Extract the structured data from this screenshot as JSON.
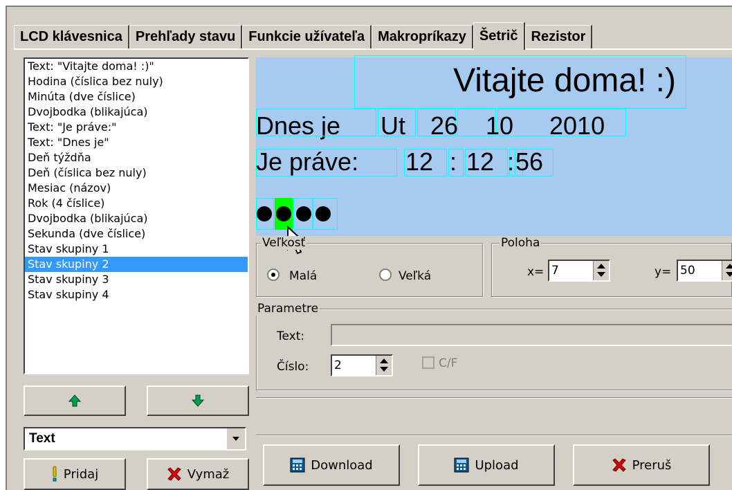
{
  "tabs": [
    "LCD klávesnica",
    "Prehľady stavu",
    "Funkcie užívateľa",
    "Makropríkazy",
    "Šetrič",
    "Rezistor"
  ],
  "active_tab": "Šetrič",
  "element_list": [
    "Text: \"Vitajte doma! :)\"",
    "Hodina (číslica bez nuly)",
    "Minúta (dve číslice)",
    "Dvojbodka (blikajúca)",
    "Text: \"Je práve:\"",
    "Text: \"Dnes je\"",
    "Deň týždňa",
    "Deň (číslica bez nuly)",
    "Mesiac (názov)",
    "Rok (4 číslice)",
    "Dvojbodka (blikajúca)",
    "Sekunda (dve číslice)",
    "Stav skupiny 1",
    "Stav skupiny 2",
    "Stav skupiny 3",
    "Stav skupiny 4"
  ],
  "selected_item": "Stav skupiny 2",
  "type_combo": "Text",
  "buttons": {
    "add": "Pridaj",
    "delete": "Vymaž",
    "download": "Download",
    "upload": "Upload",
    "abort": "Preruš"
  },
  "lcd_preview": {
    "title": "Vitajte doma! :)",
    "line1": {
      "prefix": "Dnes je",
      "weekday": "Ut",
      "day": "26",
      "month": "10",
      "year": "2010"
    },
    "line2": {
      "prefix": "Je práve:",
      "hour": "12",
      "colon1": ":",
      "minute": "12",
      "colon2": ":",
      "second": "56"
    },
    "group_indicators": 4,
    "highlighted_indicator": 2
  },
  "size_group": {
    "label": "Veľkosť",
    "small": "Malá",
    "large": "Veľká",
    "selected": "Malá"
  },
  "position_group": {
    "label": "Poloha",
    "x_label": "x=",
    "x_value": "7",
    "y_label": "y=",
    "y_value": "50"
  },
  "params_group": {
    "label": "Parametre",
    "text_label": "Text:",
    "text_value": "",
    "number_label": "Číslo:",
    "number_value": "2",
    "cf_label": "C/F"
  },
  "colors": {
    "lcd_bg": "#a6caf0",
    "selection": "#3399ff",
    "highlight": "#00ff00",
    "outline": "#00ffff"
  }
}
